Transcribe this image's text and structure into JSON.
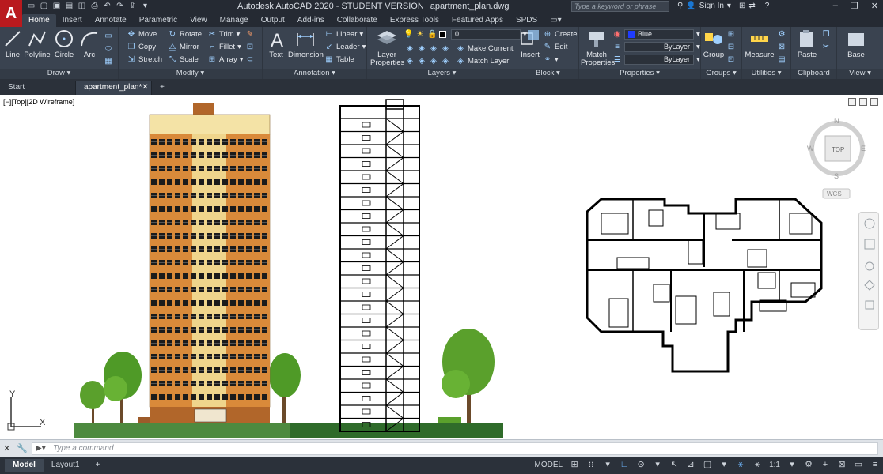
{
  "app": {
    "logo_letter": "A",
    "title": "Autodesk AutoCAD 2020 - STUDENT VERSION",
    "file_name": "apartment_plan.dwg",
    "search_placeholder": "Type a keyword or phrase",
    "sign_in": "Sign In"
  },
  "ribbon_tabs": [
    "Home",
    "Insert",
    "Annotate",
    "Parametric",
    "View",
    "Manage",
    "Output",
    "Add-ins",
    "Collaborate",
    "Express Tools",
    "Featured Apps",
    "SPDS"
  ],
  "draw": {
    "title": "Draw",
    "line": "Line",
    "polyline": "Polyline",
    "circle": "Circle",
    "arc": "Arc"
  },
  "modify": {
    "title": "Modify",
    "move": "Move",
    "rotate": "Rotate",
    "trim": "Trim",
    "copy": "Copy",
    "mirror": "Mirror",
    "fillet": "Fillet",
    "stretch": "Stretch",
    "scale": "Scale",
    "array": "Array"
  },
  "annotation": {
    "title": "Annotation",
    "text": "Text",
    "dimension": "Dimension",
    "linear": "Linear",
    "leader": "Leader",
    "table": "Table"
  },
  "layers": {
    "title": "Layers",
    "layer_properties_1": "Layer",
    "layer_properties_2": "Properties",
    "current_layer": "0",
    "make_current": "Make Current",
    "match_layer": "Match Layer"
  },
  "block": {
    "title": "Block",
    "insert": "Insert",
    "create": "Create",
    "edit": "Edit"
  },
  "properties": {
    "title": "Properties",
    "match_properties_1": "Match",
    "match_properties_2": "Properties",
    "color": "Blue",
    "color_hex": "#1f3cff",
    "linetype": "ByLayer",
    "lineweight": "ByLayer"
  },
  "groups": {
    "title": "Groups",
    "group": "Group"
  },
  "utilities": {
    "title": "Utilities",
    "measure": "Measure"
  },
  "clipboard": {
    "title": "Clipboard",
    "paste": "Paste"
  },
  "view_panel": {
    "title": "View",
    "base": "Base"
  },
  "file_tabs": {
    "start": "Start",
    "active": "apartment_plan*",
    "add": "+"
  },
  "viewport": {
    "label": "[−][Top][2D Wireframe]",
    "compass": {
      "n": "N",
      "s": "S",
      "e": "E",
      "w": "W",
      "top": "TOP",
      "wcs": "WCS"
    },
    "ucs": {
      "x": "X",
      "y": "Y"
    }
  },
  "command": {
    "placeholder": "Type a command",
    "prompt": "▶▾"
  },
  "status": {
    "layout_tabs": [
      "Model",
      "Layout1"
    ],
    "add_layout": "+",
    "model": "MODEL",
    "scale": "1:1"
  },
  "colors": {
    "ribbon_bg": "#3a4350",
    "titlebar_bg": "#252a33",
    "logo_red": "#b91a1e",
    "facade_light": "#f4e3a6",
    "facade_orange": "#d98a3a",
    "facade_brown": "#b1662a",
    "tree_green": "#5aa02c",
    "ground_green": "#4d8a3f",
    "ground_grey": "#6b7a6f"
  }
}
